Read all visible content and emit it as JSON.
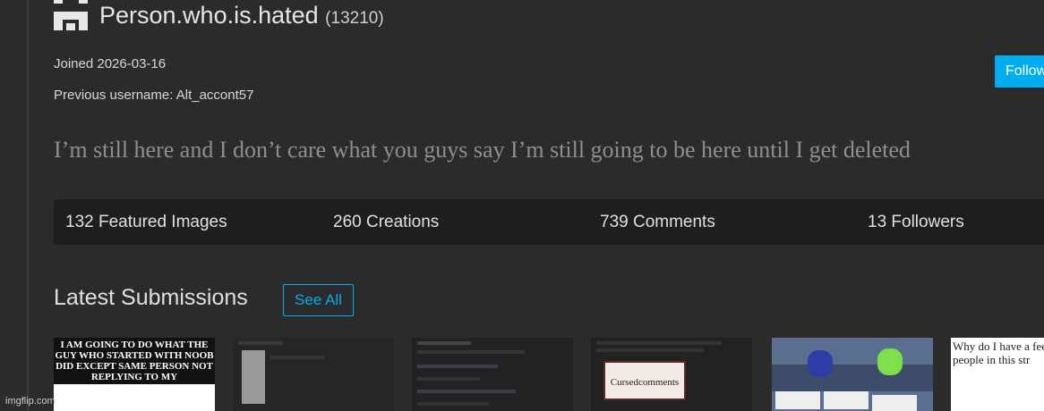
{
  "profile": {
    "username": "Person.who.is.hated",
    "points": "(13210)",
    "joined": "Joined 2026-03-16",
    "previous_username": "Previous username: Alt_accont57",
    "follow_label": "Follow",
    "bio": "I’m still here and I don’t care what you guys say I’m still going to be here until I get deleted"
  },
  "stats": {
    "featured": "132 Featured Images",
    "creations": "260 Creations",
    "comments": "739 Comments",
    "followers": "13 Followers"
  },
  "submissions": {
    "heading": "Latest Submissions",
    "see_all": "See All",
    "thumbs": [
      {
        "caption": "I AM GOING TO DO WHAT THE GUY WHO STARTED WITH NOOB DID EXCEPT SAME PERSON NOT REPLYING TO MY"
      },
      {
        "caption": ""
      },
      {
        "caption": ""
      },
      {
        "caption": "Cursedcomments"
      },
      {
        "caption": ""
      },
      {
        "caption": "Why do I have a feeling the people in this str"
      }
    ]
  },
  "watermark": "imgflip.com",
  "colors": {
    "accent": "#00aeef",
    "background": "#2b2b2b",
    "stats_bar": "#1e1e1e"
  }
}
